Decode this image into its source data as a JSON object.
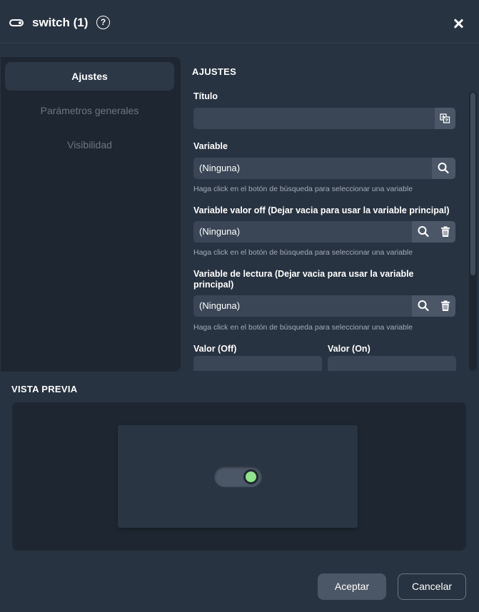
{
  "header": {
    "title": "switch (1)",
    "help_glyph": "?",
    "icons": [
      "toggle-icon",
      "help-icon",
      "close-icon"
    ]
  },
  "nav": {
    "items": [
      {
        "label": "Ajustes",
        "active": true
      },
      {
        "label": "Parámetros generales",
        "active": false
      },
      {
        "label": "Visibilidad",
        "active": false
      }
    ]
  },
  "form": {
    "section_title": "AJUSTES",
    "titulo": {
      "label": "Título",
      "value": ""
    },
    "variable": {
      "label": "Variable",
      "value": "(Ninguna)",
      "help": "Haga click en el botón de búsqueda para seleccionar una variable"
    },
    "variable_off": {
      "label": "Variable valor off (Dejar vacia para usar la variable principal)",
      "value": "(Ninguna)",
      "help": "Haga click en el botón de búsqueda para seleccionar una variable"
    },
    "variable_lectura": {
      "label": "Variable de lectura (Dejar vacia para usar la variable principal)",
      "value": "(Ninguna)",
      "help": "Haga click en el botón de búsqueda para seleccionar una variable"
    },
    "valor_off": {
      "label": "Valor (Off)",
      "value": ""
    },
    "valor_on": {
      "label": "Valor (On)",
      "value": ""
    }
  },
  "preview": {
    "title": "VISTA PREVIA",
    "switch_state": "on",
    "knob_color": "#8ee58a"
  },
  "footer": {
    "accept_label": "Aceptar",
    "cancel_label": "Cancelar"
  },
  "colors": {
    "background": "#283341",
    "panel": "#1e2731",
    "input": "#3a4656",
    "button": "#4b5766"
  }
}
